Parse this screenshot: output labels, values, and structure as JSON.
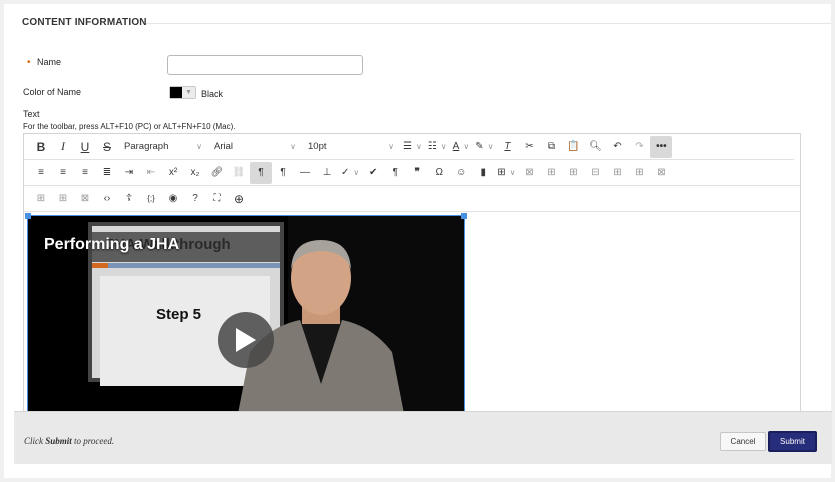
{
  "section": {
    "title": "CONTENT INFORMATION"
  },
  "name_field": {
    "required_mark": "•",
    "label": "Name",
    "value": "",
    "placeholder": ""
  },
  "color_field": {
    "label": "Color of Name",
    "value": "Black",
    "swatch": "#000000"
  },
  "text_field": {
    "label": "Text",
    "hint": "For the toolbar, press ALT+F10 (PC) or ALT+FN+F10 (Mac)."
  },
  "toolbar": {
    "bold": "B",
    "italic": "I",
    "underline": "U",
    "strike": "S",
    "paragraph": "Paragraph",
    "font": "Arial",
    "size": "10pt",
    "superscript": "x²",
    "subscript": "x₂",
    "more": "•••"
  },
  "video": {
    "overlay_title": "Performing a JHA",
    "slide_title": "JHA Walkthrough",
    "slide_step": "Step 5"
  },
  "footer": {
    "prefix": "Click ",
    "emph": "Submit",
    "suffix": " to proceed.",
    "cancel": "Cancel",
    "submit": "Submit"
  },
  "colors": {
    "accent": "#262d7a",
    "required": "#d46a0c",
    "selection": "#4a90e2"
  }
}
